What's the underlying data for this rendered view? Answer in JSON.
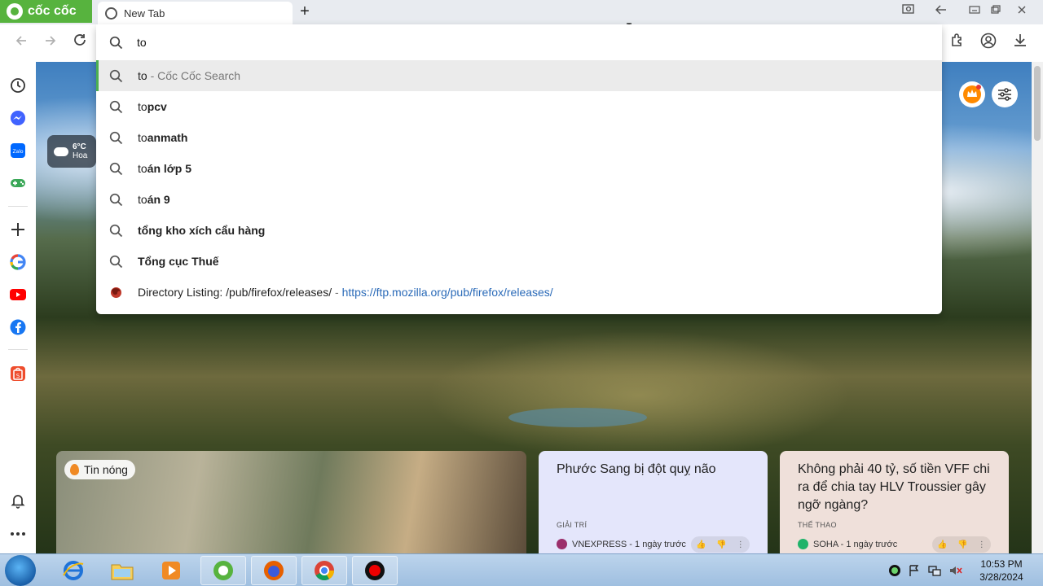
{
  "browser": {
    "brand": "cốc cốc",
    "tab_title": "New Tab",
    "new_tab_symbol": "+"
  },
  "omnibox": {
    "input_value": "to",
    "suggestions": [
      {
        "prefix": "to",
        "rest": " - Cốc Cốc Search",
        "kind": "search-engine"
      },
      {
        "prefix": "to",
        "rest": "pcv",
        "kind": "query"
      },
      {
        "prefix": "to",
        "rest": "anmath",
        "kind": "query"
      },
      {
        "prefix": "to",
        "rest": "án lớp 5",
        "kind": "query"
      },
      {
        "prefix": "to",
        "rest": "án 9",
        "kind": "query"
      },
      {
        "prefix": "",
        "rest": "tổng kho xích cẩu hàng",
        "kind": "query"
      },
      {
        "prefix": "",
        "rest": "Tổng cục Thuế",
        "kind": "query"
      }
    ],
    "history_item": {
      "title": "Directory Listing: /pub/firefox/releases/",
      "separator": " - ",
      "url": "https://ftp.mozilla.org/pub/firefox/releases/"
    }
  },
  "weather": {
    "temp": "6°C",
    "location": "Hoa"
  },
  "news": {
    "hot_badge": "Tin nóng",
    "cards": [
      {
        "title": "Phước Sang bị đột quỵ não",
        "category": "GIẢI TRÍ",
        "source": "VNEXPRESS - 1 ngày trước",
        "source_color": "#9b2f6b"
      },
      {
        "title": "Không phải 40 tỷ, số tiền VFF chi ra để chia tay HLV Troussier gây ngỡ ngàng?",
        "category": "THỂ THAO",
        "source": "SOHA - 1 ngày trước",
        "source_color": "#1fb36a"
      }
    ]
  },
  "taskbar": {
    "time": "10:53 PM",
    "date": "3/28/2024"
  }
}
